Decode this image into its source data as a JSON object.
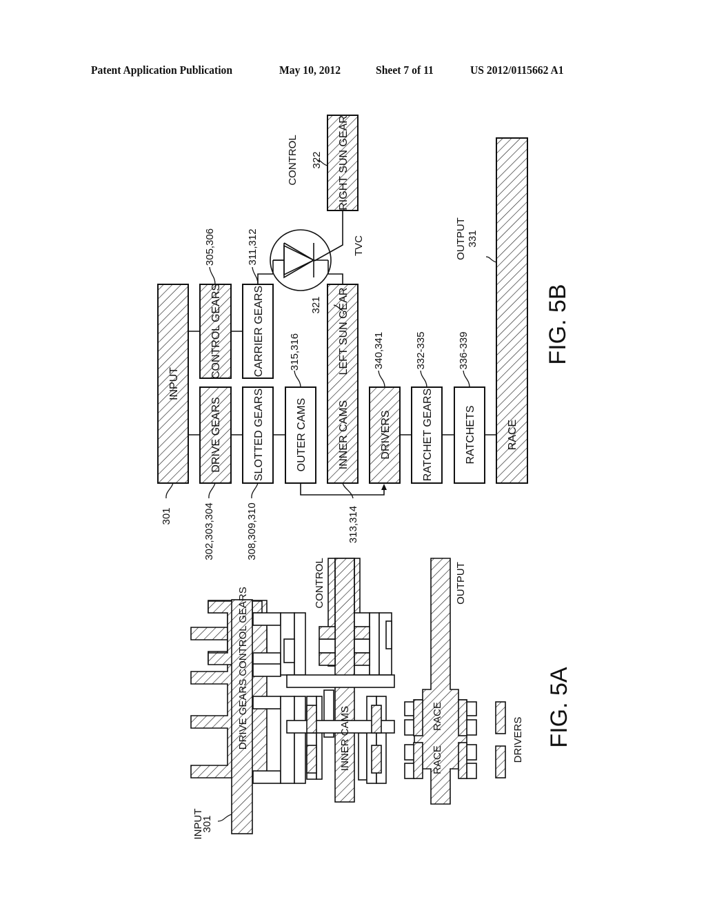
{
  "header": {
    "publication": "Patent Application Publication",
    "date": "May 10, 2012",
    "sheet": "Sheet 7 of 11",
    "number": "US 2012/0115662 A1"
  },
  "fig5b": {
    "caption": "FIG. 5B",
    "blocks": {
      "input": "INPUT",
      "drive_gears": "DRIVE GEARS",
      "control_gears": "CONTROL GEARS",
      "slotted_gears": "SLOTTED GEARS",
      "carrier_gears": "CARRIER GEARS",
      "outer_cams": "OUTER CAMS",
      "inner_cams": "INNER CAMS",
      "left_sun_gear": "LEFT SUN GEAR",
      "right_sun_gear": "RIGHT SUN GEAR",
      "drivers": "DRIVERS",
      "ratchet_gears": "RATCHET GEARS",
      "ratchets": "RATCHETS",
      "race": "RACE"
    },
    "refs": {
      "input": "301",
      "drive_gears": "302,303,304",
      "control_gears": "305,306",
      "slotted_gears": "308,309,310",
      "carrier_gears": "311,312",
      "inner_cams": "313,314",
      "outer_cams": "315,316",
      "left_sun_gear": "321",
      "right_sun_gear": "322",
      "drivers": "340,341",
      "ratchet_gears": "332-335",
      "ratchets": "336-339",
      "output": "331"
    },
    "annotations": {
      "control": "CONTROL",
      "tvc": "TVC",
      "output": "OUTPUT"
    }
  },
  "fig5a": {
    "caption": "FIG. 5A",
    "labels": {
      "input": "INPUT",
      "input_ref": "301",
      "drive_gears": "DRIVE GEARS",
      "control_gears": "CONTROL GEARS",
      "control": "CONTROL",
      "inner_cams": "INNER CAMS",
      "race_1": "RACE",
      "race_2": "RACE",
      "output": "OUTPUT",
      "drivers": "DRIVERS"
    }
  }
}
